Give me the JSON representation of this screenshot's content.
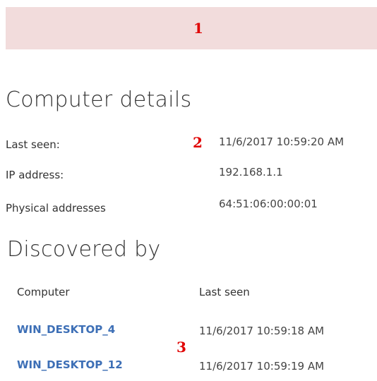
{
  "banner": {
    "marker": "1",
    "background": "#f2dcdc",
    "marker_color": "#e00000"
  },
  "details": {
    "title": "Computer details",
    "marker": "2",
    "rows": [
      {
        "label": "Last seen:",
        "value": "11/6/2017 10:59:20 AM"
      },
      {
        "label": "IP address:",
        "value": "192.168.1.1"
      },
      {
        "label": "Physical addresses",
        "value": "64:51:06:00:00:01"
      }
    ]
  },
  "discovered": {
    "title": "Discovered by",
    "marker": "3",
    "columns": [
      "Computer",
      "Last seen"
    ],
    "rows": [
      {
        "computer": "WIN_DESKTOP_4",
        "last_seen": "11/6/2017 10:59:18 AM"
      },
      {
        "computer": "WIN_DESKTOP_12",
        "last_seen": "11/6/2017 10:59:19 AM"
      }
    ],
    "link_color": "#3d6fb6"
  }
}
